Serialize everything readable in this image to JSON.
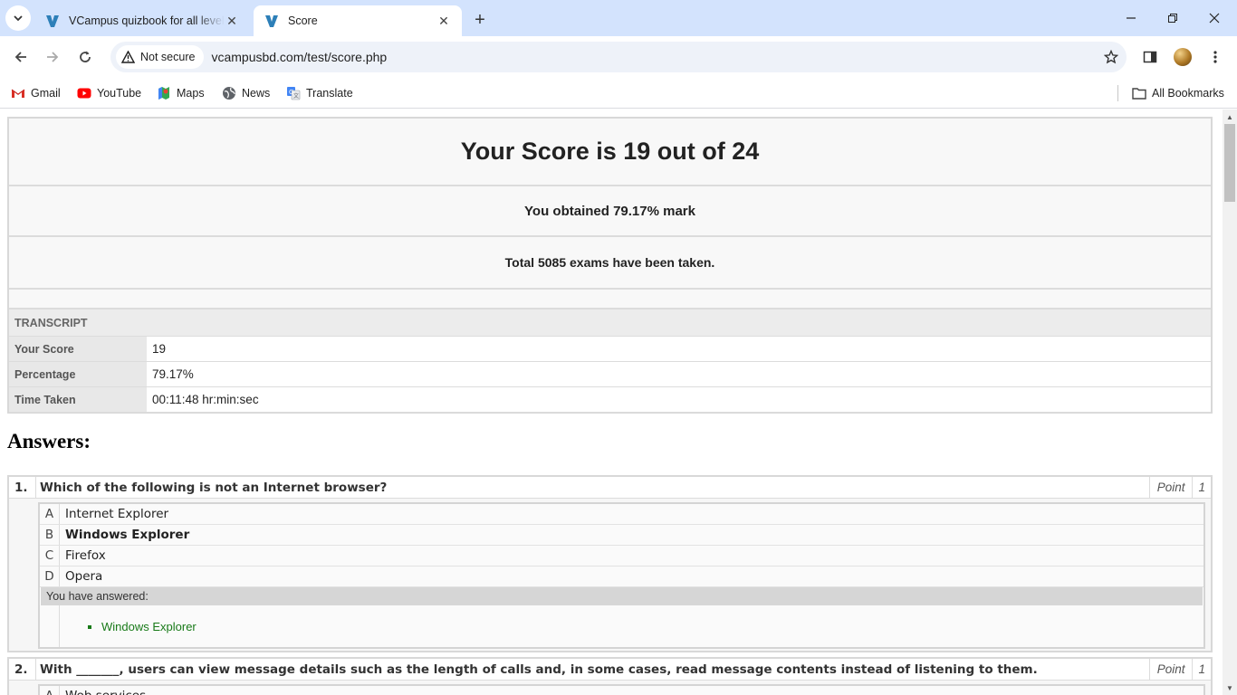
{
  "browser": {
    "tabs": [
      {
        "title": "VCampus quizbook for all levels",
        "active": false
      },
      {
        "title": "Score",
        "active": true
      }
    ],
    "security_label": "Not secure",
    "url": "vcampusbd.com/test/score.php",
    "bookmarks": [
      "Gmail",
      "YouTube",
      "Maps",
      "News",
      "Translate"
    ],
    "all_bookmarks": "All Bookmarks"
  },
  "score": {
    "headline": "Your Score is 19 out of 24",
    "obtained": "You obtained 79.17% mark",
    "total": "Total 5085 exams have been taken."
  },
  "transcript": {
    "heading": "TRANSCRIPT",
    "rows": [
      {
        "label": "Your Score",
        "value": "19"
      },
      {
        "label": "Percentage",
        "value": "79.17%"
      },
      {
        "label": "Time Taken",
        "value": "00:11:48 hr:min:sec"
      }
    ]
  },
  "answers": {
    "heading": "Answers:",
    "questions": [
      {
        "number": "1.",
        "text": "Which of the following is not an Internet browser?",
        "point_label": "Point",
        "point": "1",
        "options": [
          {
            "letter": "A",
            "text": "Internet Explorer"
          },
          {
            "letter": "B",
            "text": "Windows Explorer"
          },
          {
            "letter": "C",
            "text": "Firefox"
          },
          {
            "letter": "D",
            "text": "Opera"
          }
        ],
        "answered_label": "You have answered:",
        "answer": "Windows Explorer"
      },
      {
        "number": "2.",
        "text": "With _______, users can view message details such as the length of calls and, in some cases, read message contents instead of listening to them.",
        "point_label": "Point",
        "point": "1",
        "options": [
          {
            "letter": "A",
            "text": "Web services"
          }
        ]
      }
    ]
  },
  "colors": {
    "tabbar": "#d3e3fd",
    "correct_answer": "#187a18"
  }
}
